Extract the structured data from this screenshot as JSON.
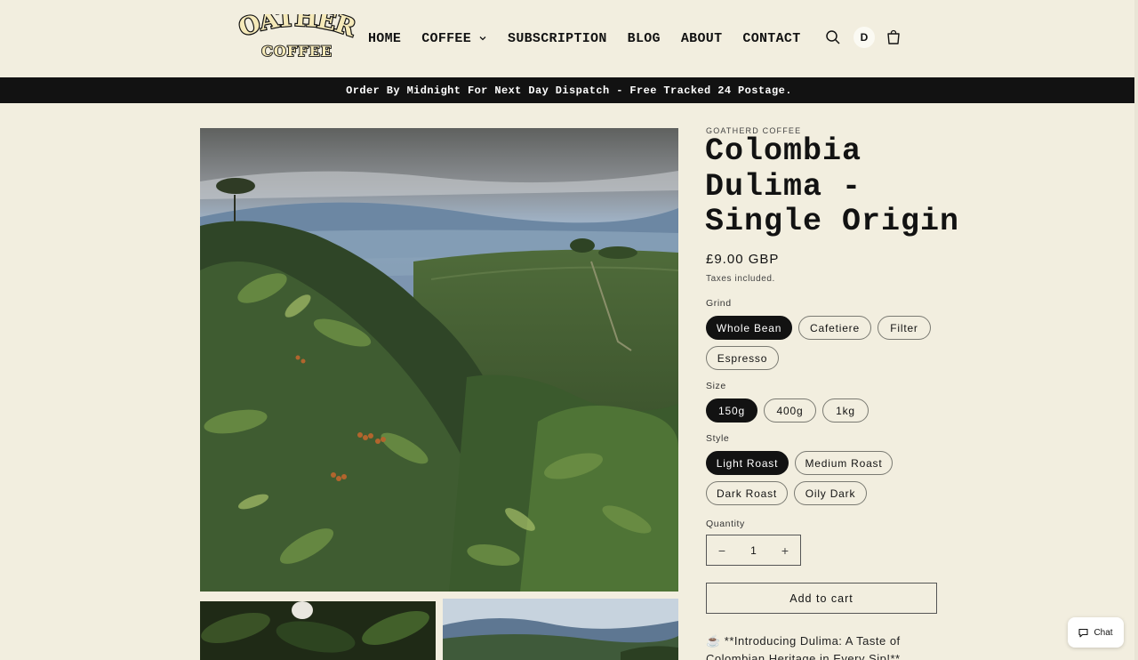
{
  "header": {
    "logo": {
      "top_text": "GOATHERD",
      "bottom_text": "COFFEE"
    },
    "nav": [
      {
        "label": "HOME"
      },
      {
        "label": "COFFEE",
        "has_dropdown": true
      },
      {
        "label": "SUBSCRIPTION"
      },
      {
        "label": "BLOG"
      },
      {
        "label": "ABOUT"
      },
      {
        "label": "CONTACT"
      }
    ],
    "icons": [
      "search-icon",
      "account-avatar",
      "cart-icon"
    ],
    "account_initial": "D"
  },
  "announcement": "Order By Midnight For Next Day Dispatch - Free Tracked 24 Postage.",
  "product": {
    "vendor": "GOATHERD COFFEE",
    "title_lines": [
      "Colombia",
      "Dulima -",
      "Single Origin"
    ],
    "price": "£9.00 GBP",
    "tax_note": "Taxes included.",
    "grind": {
      "label": "Grind",
      "options": [
        "Whole Bean",
        "Cafetiere",
        "Filter",
        "Espresso"
      ],
      "selected": "Whole Bean"
    },
    "size": {
      "label": "Size",
      "options": [
        "150g",
        "400g",
        "1kg"
      ],
      "selected": "150g"
    },
    "style": {
      "label": "Style",
      "options": [
        "Light Roast",
        "Medium Roast",
        "Dark Roast",
        "Oily Dark"
      ],
      "selected": "Light Roast"
    },
    "quantity": {
      "label": "Quantity",
      "value": "1",
      "minus": "−",
      "plus": "+"
    },
    "add_to_cart": "Add to cart",
    "description_lines": [
      "☕ **Introducing Dulima: A Taste of",
      "Colombian Heritage in Every Sip!**"
    ]
  },
  "chat": {
    "label": "Chat"
  },
  "colors": {
    "background": "#f2eedf",
    "ink": "#121212",
    "announcement_bg": "#121212"
  }
}
